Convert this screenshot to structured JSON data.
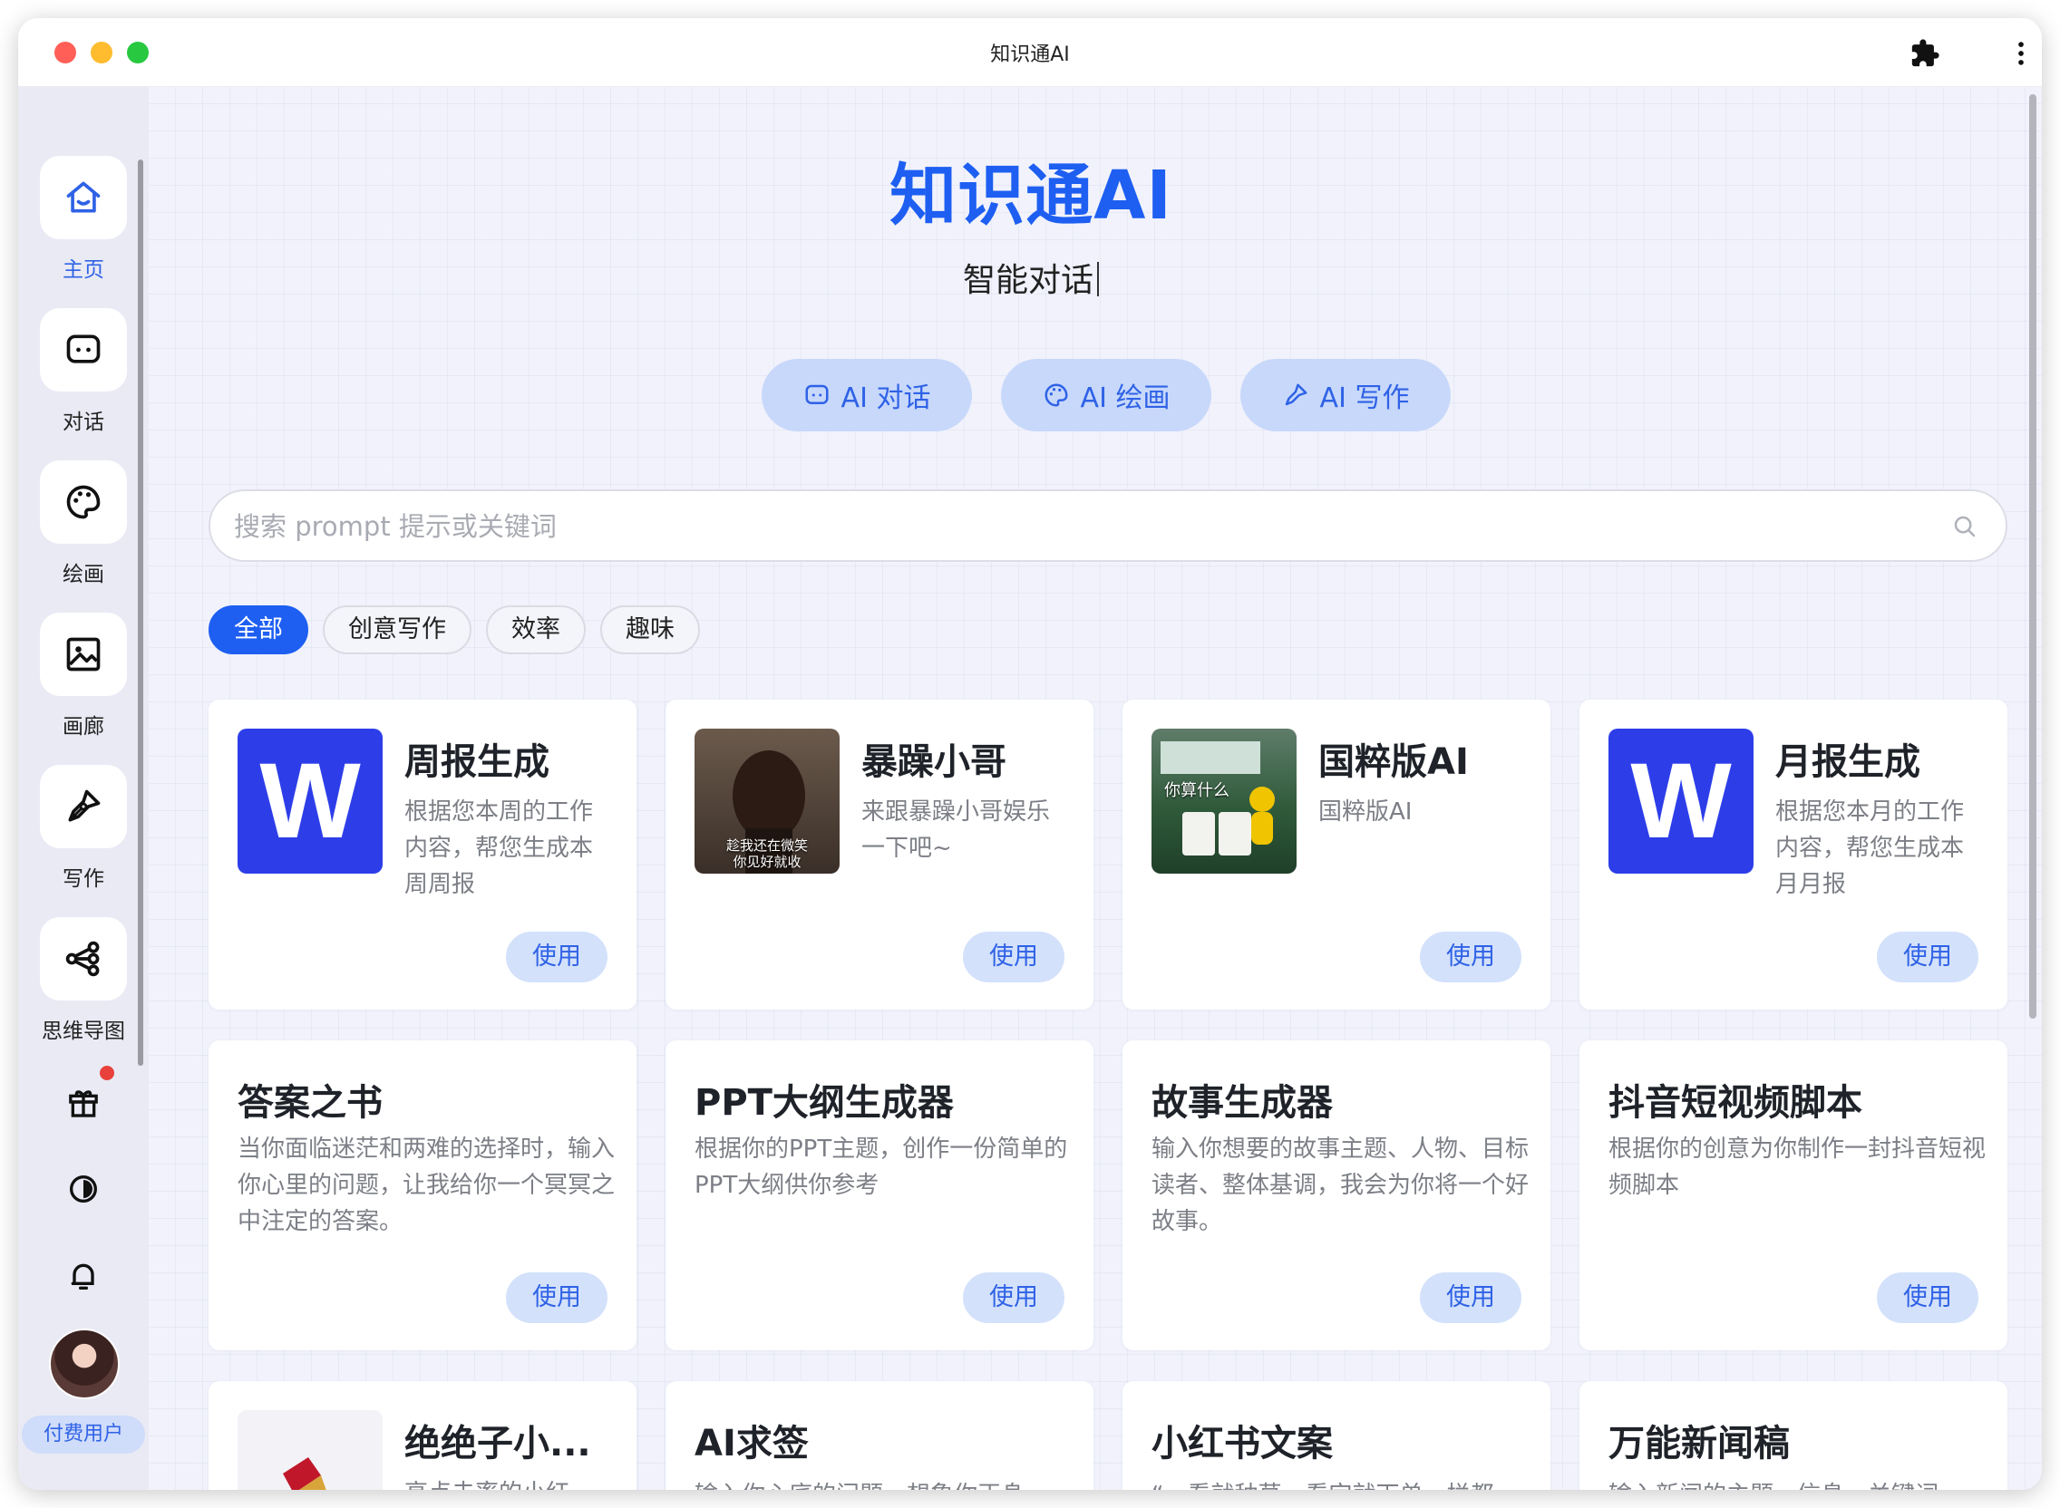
{
  "window": {
    "title": "知识通AI"
  },
  "sidebar": {
    "items": [
      {
        "label": "主页",
        "icon": "home-icon",
        "active": true
      },
      {
        "label": "对话",
        "icon": "chat-icon"
      },
      {
        "label": "绘画",
        "icon": "palette-icon"
      },
      {
        "label": "画廊",
        "icon": "gallery-icon"
      },
      {
        "label": "写作",
        "icon": "pen-icon"
      },
      {
        "label": "思维导图",
        "icon": "mindmap-icon"
      }
    ],
    "bottom_icons": [
      "gift-icon",
      "contrast-icon",
      "bell-icon"
    ],
    "user_badge": "付费用户"
  },
  "hero": {
    "title": "知识通AI",
    "subtitle": "智能对话",
    "buttons": [
      "AI 对话",
      "AI 绘画",
      "AI 写作"
    ]
  },
  "search": {
    "placeholder": "搜索 prompt 提示或关键词",
    "value": ""
  },
  "categories": [
    "全部",
    "创意写作",
    "效率",
    "趣味"
  ],
  "active_category": "全部",
  "use_label": "使用",
  "cards": [
    {
      "title": "周报生成",
      "desc": "根据您本周的工作内容，帮您生成本周周报",
      "thumb": "W"
    },
    {
      "title": "暴躁小哥",
      "desc": "来跟暴躁小哥娱乐一下吧~",
      "thumb_caption": "趁我还在微笑\n你见好就收"
    },
    {
      "title": "国粹版AI",
      "desc": "国粹版AI",
      "thumb_caption": "你算什么"
    },
    {
      "title": "月报生成",
      "desc": "根据您本月的工作内容，帮您生成本月月报",
      "thumb": "W"
    },
    {
      "title": "答案之书",
      "desc": "当你面临迷茫和两难的选择时，输入你心里的问题，让我给你一个冥冥之中注定的答案。"
    },
    {
      "title": "PPT大纲生成器",
      "desc": "根据你的PPT主题，创作一份简单的PPT大纲供你参考"
    },
    {
      "title": "故事生成器",
      "desc": "输入你想要的故事主题、人物、目标读者、整体基调，我会为你将一个好故事。"
    },
    {
      "title": "抖音短视频脚本",
      "desc": "根据你的创意为你制作一封抖音短视频脚本"
    },
    {
      "title": "绝绝子小...",
      "desc": "高点击率的小红"
    },
    {
      "title": "AI求签",
      "desc": "输入你心底的问题，想象你正身"
    },
    {
      "title": "小红书文案",
      "desc": "“一看就种草，看完就下单，拦都"
    },
    {
      "title": "万能新闻稿",
      "desc": "输入新闻的主题、信息、关键词"
    }
  ],
  "colors": {
    "accent": "#1e5ff2",
    "pill_bg": "#c7d8fb",
    "word_blue": "#2d3ee9",
    "badge_red": "#e8413c"
  }
}
